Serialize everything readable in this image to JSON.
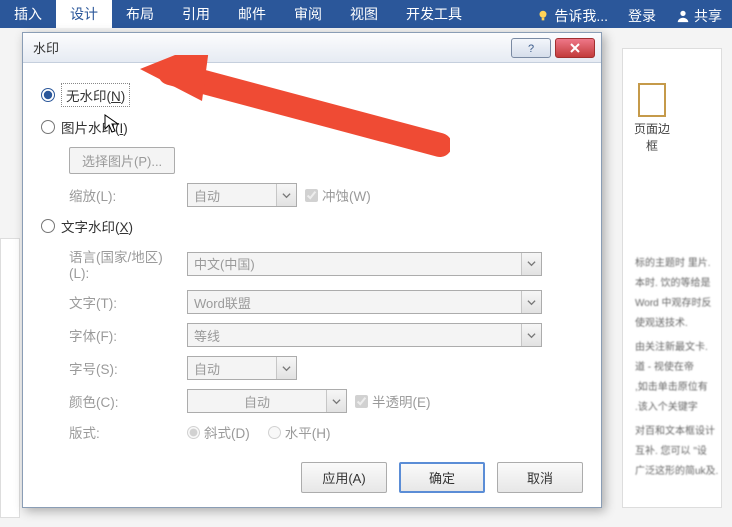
{
  "ribbon": {
    "tabs": [
      "插入",
      "设计",
      "布局",
      "引用",
      "邮件",
      "审阅",
      "视图",
      "开发工具"
    ],
    "active_index": 1,
    "tell_me": "告诉我...",
    "login": "登录",
    "share": "共享"
  },
  "page_border_label": "页面边框",
  "dialog": {
    "title": "水印",
    "no_watermark": {
      "label": "无水印",
      "accel": "N"
    },
    "picture_watermark": {
      "label": "图片水印",
      "accel": "I"
    },
    "text_watermark": {
      "label": "文字水印",
      "accel": "X"
    },
    "select_picture_btn": "选择图片(P)...",
    "scale": {
      "label": "缩放(L):",
      "value": "自动"
    },
    "washout": {
      "label": "冲蚀(W)"
    },
    "language": {
      "label": "语言(国家/地区)(L):",
      "value": "中文(中国)"
    },
    "text": {
      "label": "文字(T):",
      "value": "Word联盟"
    },
    "font": {
      "label": "字体(F):",
      "value": "等线"
    },
    "size": {
      "label": "字号(S):",
      "value": "自动"
    },
    "color": {
      "label": "颜色(C):",
      "value": "自动"
    },
    "semi": {
      "label": "半透明(E)"
    },
    "layout": {
      "label": "版式:",
      "diagonal": "斜式(D)",
      "horizontal": "水平(H)"
    },
    "buttons": {
      "apply": "应用(A)",
      "ok": "确定",
      "cancel": "取消"
    }
  }
}
